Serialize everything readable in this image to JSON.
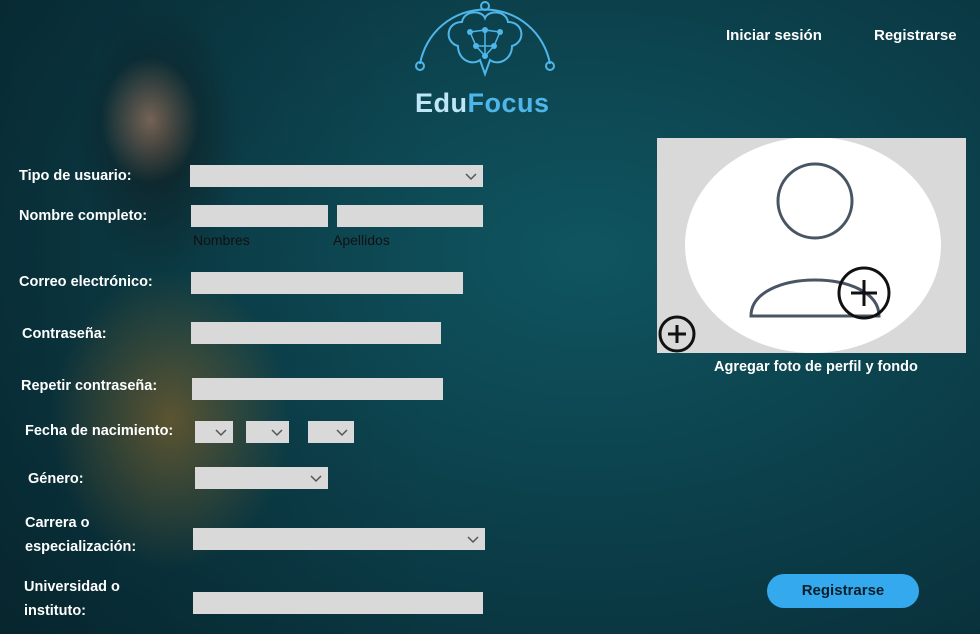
{
  "brand": {
    "name_part1": "Edu",
    "name_part2": "Focus",
    "logo_icon": "brain-circuit-icon"
  },
  "nav": {
    "login": "Iniciar sesión",
    "register": "Registrarse"
  },
  "form": {
    "user_type": {
      "label": "Tipo de usuario:",
      "value": ""
    },
    "full_name": {
      "label": "Nombre completo:",
      "first_sub": "Nombres",
      "last_sub": "Apellidos",
      "first_value": "",
      "last_value": ""
    },
    "email": {
      "label": "Correo electrónico:",
      "value": ""
    },
    "password": {
      "label": "Contraseña:",
      "value": ""
    },
    "repeat_password": {
      "label": "Repetir contraseña:",
      "value": ""
    },
    "birth_date": {
      "label": "Fecha de nacimiento:",
      "day": "",
      "month": "",
      "year": ""
    },
    "gender": {
      "label": "Género:",
      "value": ""
    },
    "career": {
      "label_line1": "Carrera o",
      "label_line2": "especialización:",
      "value": ""
    },
    "university": {
      "label_line1": "Universidad o",
      "label_line2": "instituto:",
      "value": ""
    }
  },
  "profile": {
    "caption": "Agregar foto de perfil y fondo",
    "avatar_icon": "user-avatar-icon",
    "add_icon": "plus-circle-icon"
  },
  "submit": {
    "label": "Registrarse"
  },
  "colors": {
    "background": "#0b3d48",
    "accent": "#35a9ee",
    "field": "#d9d9d9"
  }
}
